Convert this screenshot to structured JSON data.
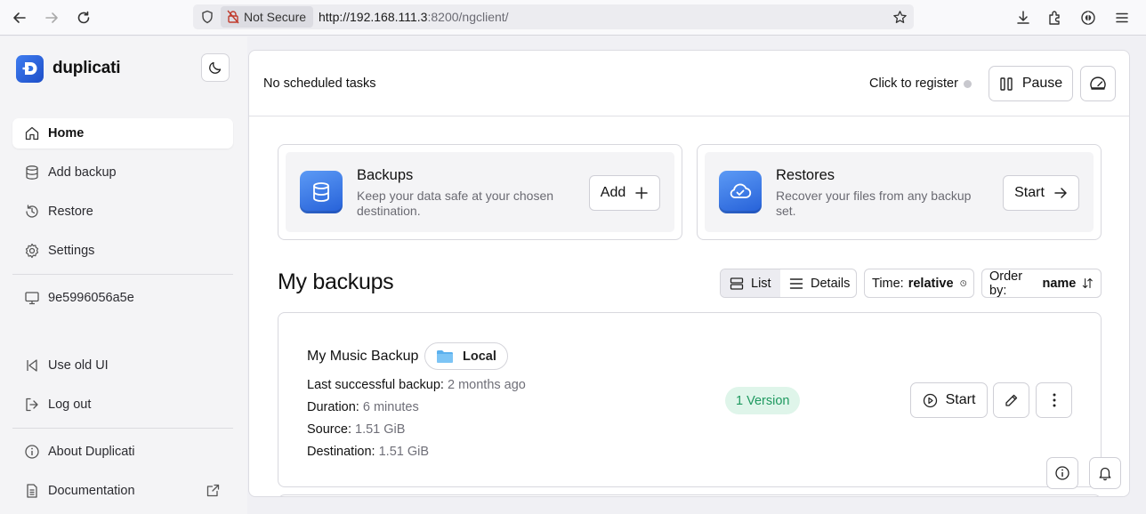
{
  "browser": {
    "security_label": "Not Secure",
    "url_host": "http://192.168.111.3",
    "url_rest": ":8200/ngclient/"
  },
  "app": {
    "name": "duplicati"
  },
  "sidebar": {
    "items": [
      {
        "label": "Home",
        "icon": "home-icon",
        "active": true
      },
      {
        "label": "Add backup",
        "icon": "database-icon"
      },
      {
        "label": "Restore",
        "icon": "history-icon"
      },
      {
        "label": "Settings",
        "icon": "gear-icon"
      }
    ],
    "machine_label": "9e5996056a5e",
    "use_old_ui": "Use old UI",
    "log_out": "Log out",
    "about": "About Duplicati",
    "documentation": "Documentation"
  },
  "header": {
    "schedule_text": "No scheduled tasks",
    "register_text": "Click to register",
    "pause_label": "Pause"
  },
  "cards": {
    "backups": {
      "title": "Backups",
      "description": "Keep your data safe at your chosen destination.",
      "button": "Add"
    },
    "restores": {
      "title": "Restores",
      "description": "Recover your files from any backup set.",
      "button": "Start"
    }
  },
  "my_backups": {
    "title": "My backups",
    "view_list": "List",
    "view_details": "Details",
    "time_label": "Time:",
    "time_value": "relative",
    "order_label": "Order by:",
    "order_value": "name"
  },
  "backup": {
    "name": "My Music Backup",
    "destination": "Local",
    "last_label": "Last successful backup:",
    "last_value": "2 months ago",
    "duration_label": "Duration:",
    "duration_value": "6 minutes",
    "source_label": "Source:",
    "source_value": "1.51 GiB",
    "destination_label": "Destination:",
    "destination_value": "1.51 GiB",
    "versions": "1 Version",
    "start_label": "Start"
  },
  "colors": {
    "accent": "#2f6fe4",
    "success_bg": "#dff5ea",
    "success_text": "#1f9960"
  }
}
